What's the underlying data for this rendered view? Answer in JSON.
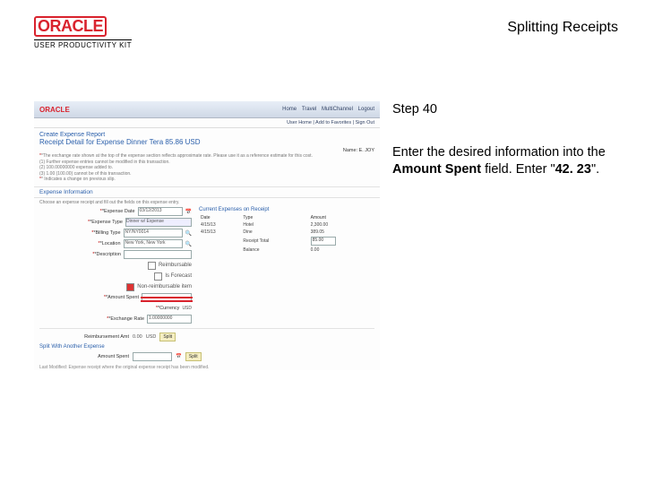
{
  "header": {
    "brand": "ORACLE",
    "subbrand": "USER PRODUCTIVITY KIT",
    "page_title": "Splitting Receipts"
  },
  "side": {
    "step_label": "Step 40",
    "instr_pre": "Enter the desired information into the ",
    "instr_field": "Amount Spent",
    "instr_mid": " field. Enter \"",
    "instr_value": "42. 23",
    "instr_post": "\"."
  },
  "app": {
    "logo": "ORACLE",
    "nav": [
      "Home",
      "Travel",
      "MultiChannel",
      "Logout"
    ],
    "subnav": "User Home | Add to Favorites | Sign Out",
    "crumb": "Create Expense Report",
    "receipt_title": "Receipt Detail for Expense Dinner  Tera 85.86 USD",
    "name": "Name: E. JOY",
    "notes": [
      "*The exchange rate shown at the top of the expense section reflects approximate rate. Please use it as a reference estimate for this cost.",
      "(1) Further expense entries cannot be modified in this transaction.",
      "(2) 100.00000000 expense added to.",
      "(3) 1.00 (100.00) cannot be of this transaction.",
      "* Indicates a change on previous slip."
    ],
    "exp_info_label": "Expense Information",
    "hint": "Choose an expense receipt and fill out the fields on this expense entry.",
    "form": {
      "date_label": "*Expense Date",
      "date_value": "03/12/2013",
      "type_label": "*Expense Type",
      "type_value": "Dinner w/ Expense",
      "billing_label": "*Billing Type",
      "billing_value": "NY/NY0014",
      "location_label": "*Location",
      "location_value": "New York, New York",
      "desc_label": "*Description",
      "reimb_label": "Reimbursable",
      "ir_label": "Is Forecast",
      "nonreimb_label": "Non-reimbursable item",
      "amount_label": "*Amount Spent",
      "currency_label": "*Currency",
      "currency_value": "USD",
      "rate_label": "*Exchange Rate",
      "rate_value": "1.00000000"
    },
    "table": {
      "title": "Current Expenses on Receipt",
      "cols": [
        "Date",
        "Type",
        "Amount"
      ],
      "rows": [
        [
          "4/15/13",
          "Hotel",
          "2,300.00"
        ],
        [
          "4/15/13",
          "Dine",
          "389.05"
        ]
      ],
      "total_label": "Receipt Total",
      "total_amount": "85.00",
      "balance_label": "Balance",
      "balance_amount": "0.00"
    },
    "reimb": {
      "label": "Reimbursement Amt",
      "value": "0.00",
      "curr": "USD",
      "btn": "Split"
    },
    "split_header": "Split With Another Expense",
    "spent": {
      "label": "Amount Spent",
      "btn": "Split"
    },
    "footer": "Last Modified: Expense receipt where the original expense receipt has been modified."
  }
}
